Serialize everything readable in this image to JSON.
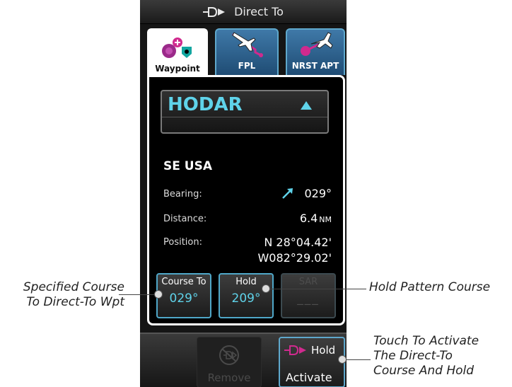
{
  "titlebar": {
    "title": "Direct To",
    "icon": "direct-to-icon"
  },
  "tabs": [
    {
      "label": "Waypoint",
      "active": true,
      "icon": "waypoint-icon"
    },
    {
      "label": "FPL",
      "active": false,
      "icon": "flight-plan-icon"
    },
    {
      "label": "NRST APT",
      "active": false,
      "icon": "nearest-airport-icon"
    }
  ],
  "waypoint": {
    "ident": "HODAR",
    "region": "SE USA"
  },
  "info": {
    "bearing_label": "Bearing:",
    "bearing_value": "029°",
    "distance_label": "Distance:",
    "distance_value": "6.4",
    "distance_unit": "NM",
    "position_label": "Position:",
    "position_lat": "N 28°04.42'",
    "position_lon": "W082°29.02'"
  },
  "buttons": {
    "course_to_label": "Course To",
    "course_to_value": "029°",
    "hold_label": "Hold",
    "hold_value": "209°",
    "sar_label": "SAR",
    "sar_value": "___"
  },
  "bottom": {
    "remove_label": "Remove",
    "hold_label": "Hold",
    "activate_label": "Activate"
  },
  "annotations": {
    "left_line1": "Specified Course",
    "left_line2": "To Direct-To Wpt",
    "right": "Hold Pattern Course",
    "bottom_line1": "Touch To Activate",
    "bottom_line2": "The Direct-To",
    "bottom_line3": "Course And Hold"
  },
  "colors": {
    "accent_cyan": "#5fd3ea",
    "button_border": "#4fa7c8",
    "tab_blue": "#3f79a8"
  }
}
